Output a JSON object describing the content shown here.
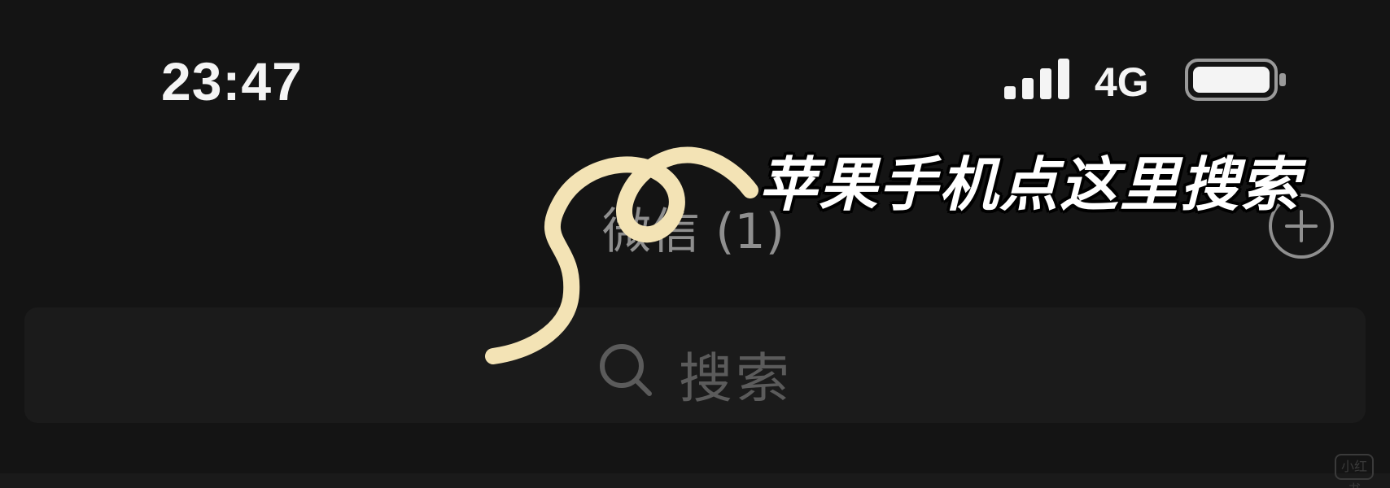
{
  "status_bar": {
    "time": "23:47",
    "network": "4G",
    "signal_icon": "signal-bars-icon",
    "battery_icon": "battery-icon"
  },
  "nav": {
    "title": "微信 (1)",
    "add_icon": "plus-circle-icon"
  },
  "search": {
    "placeholder": "搜索",
    "icon": "search-icon"
  },
  "annotation": {
    "text": "苹果手机点这里搜索",
    "color": "#F3E3B5"
  },
  "watermark": {
    "text": "小红书"
  },
  "colors": {
    "background": "#141414",
    "search_bar": "#1B1B1B",
    "accent_squiggle": "#F3E3B5"
  }
}
